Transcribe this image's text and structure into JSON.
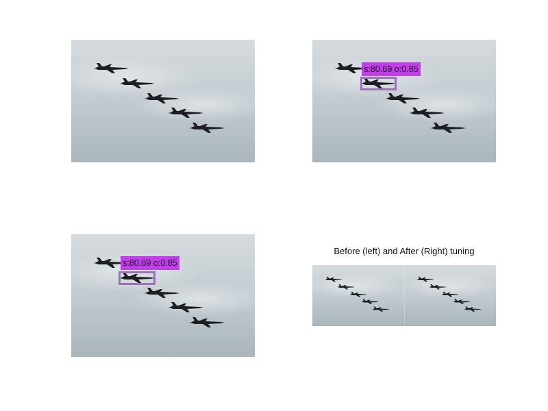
{
  "panels": [
    {
      "id": "original",
      "detection": null
    },
    {
      "id": "after-tuning",
      "detection": {
        "label": "s:80.69 o:0.85",
        "box_color": "#9a72b8",
        "label_bg": "#bf40e6"
      }
    },
    {
      "id": "before-tuning",
      "detection": {
        "label": "s:80.69 o:0.85",
        "box_color": "#9a72b8",
        "label_bg": "#bf40e6"
      }
    },
    {
      "id": "comparison",
      "caption": "Before (left) and After (Right) tuning"
    }
  ],
  "scene": {
    "sky_top": "#d7dde0",
    "sky_bottom": "#aeb9bf",
    "aircraft_color": "#1c1e22",
    "aircraft_count": 5
  }
}
